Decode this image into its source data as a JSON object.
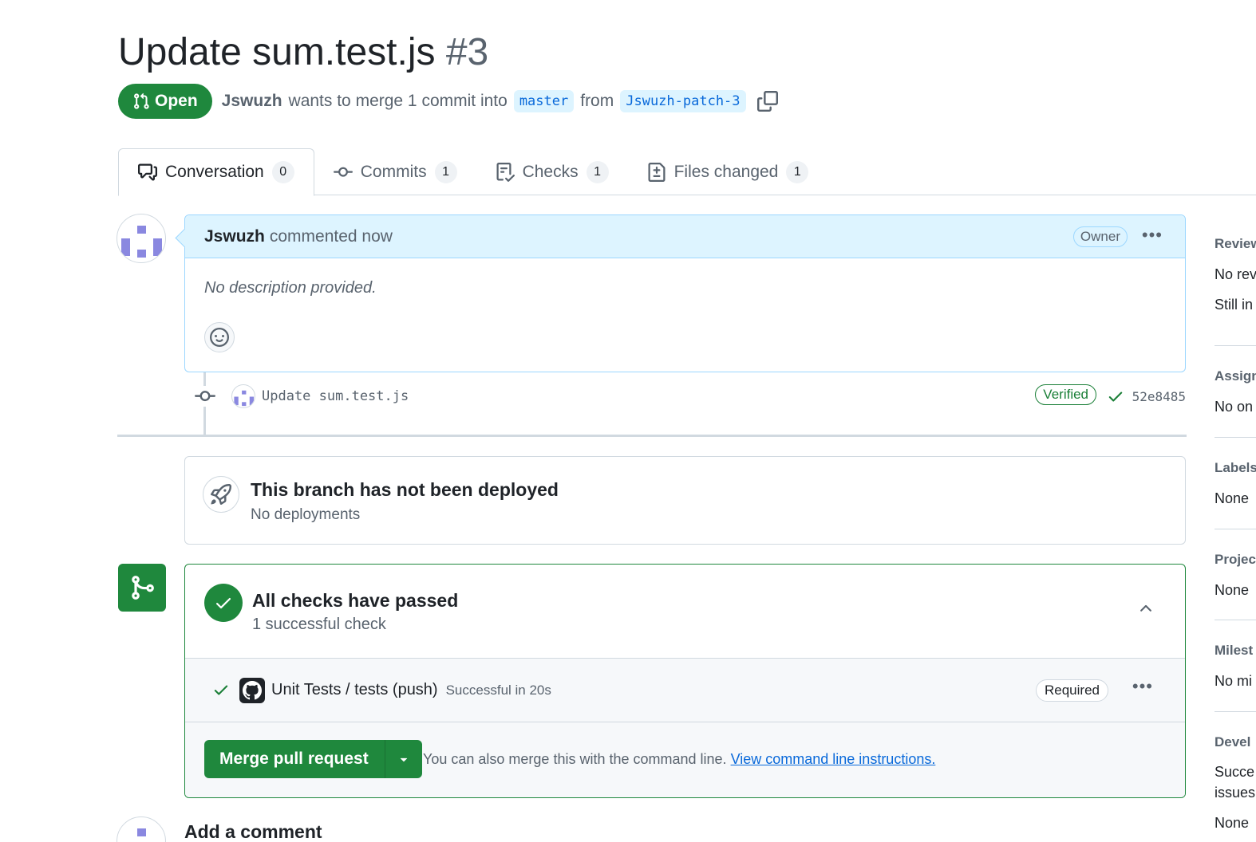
{
  "pr": {
    "title": "Update sum.test.js",
    "number": "#3",
    "state": "Open",
    "author": "Jswuzh",
    "merge_text": "wants to merge 1 commit into",
    "base_branch": "master",
    "from_text": "from",
    "head_branch": "Jswuzh-patch-3"
  },
  "tabs": [
    {
      "label": "Conversation",
      "count": "0"
    },
    {
      "label": "Commits",
      "count": "1"
    },
    {
      "label": "Checks",
      "count": "1"
    },
    {
      "label": "Files changed",
      "count": "1"
    }
  ],
  "comment": {
    "author": "Jswuzh",
    "time": "commented now",
    "badge": "Owner",
    "body": "No description provided."
  },
  "commit": {
    "message": "Update sum.test.js",
    "verified": "Verified",
    "sha": "52e8485"
  },
  "deploy": {
    "title": "This branch has not been deployed",
    "subtitle": "No deployments"
  },
  "checks": {
    "title": "All checks have passed",
    "subtitle": "1 successful check",
    "item_name": "Unit Tests / tests (push)",
    "item_status": "Successful in 20s",
    "item_badge": "Required"
  },
  "merge": {
    "button": "Merge pull request",
    "hint": "You can also merge this with the command line.",
    "link": "View command line instructions."
  },
  "add_comment": "Add a comment",
  "sidebar": [
    {
      "heading": "Review",
      "lines": [
        "No rev",
        "Still in"
      ]
    },
    {
      "heading": "Assign",
      "lines": [
        "No on"
      ]
    },
    {
      "heading": "Labels",
      "lines": [
        "None"
      ]
    },
    {
      "heading": "Projec",
      "lines": [
        "None"
      ]
    },
    {
      "heading": "Milest",
      "lines": [
        "No mi"
      ]
    },
    {
      "heading": "Devel",
      "lines": [
        "Succe",
        "issues",
        "None"
      ]
    }
  ],
  "colors": {
    "green": "#1f883d",
    "blue_bg": "#ddf4ff",
    "link": "#0969da",
    "avatar_purple": "#8a88e0"
  }
}
